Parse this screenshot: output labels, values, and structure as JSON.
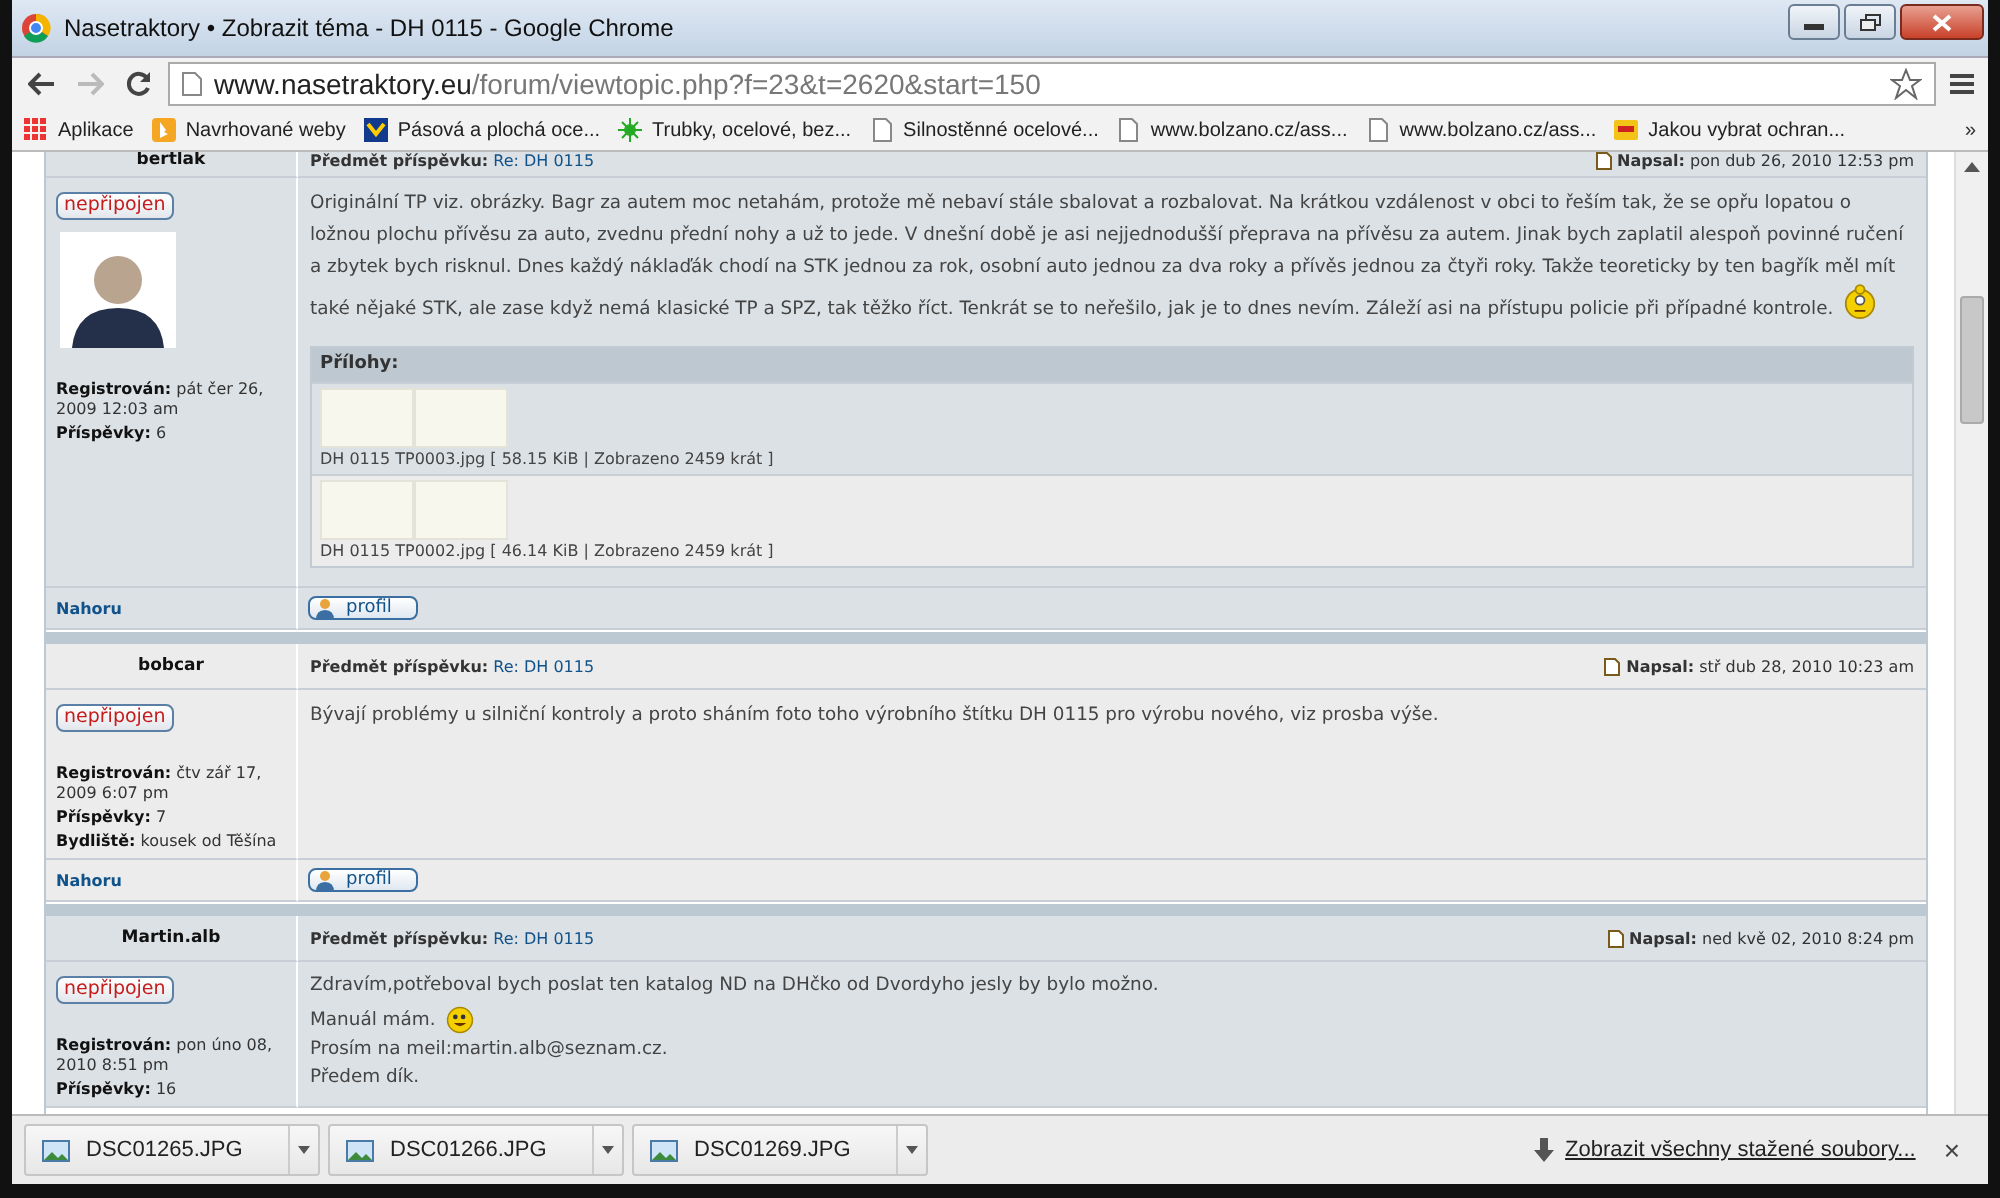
{
  "window": {
    "title": "Nasetraktory • Zobrazit téma - DH 0115 - Google Chrome"
  },
  "address_bar": {
    "domain": "www.nasetraktory.eu",
    "path": "/forum/viewtopic.php?f=23&t=2620&start=150"
  },
  "bookmarks": [
    {
      "label": "Aplikace",
      "kind": "apps"
    },
    {
      "label": "Navrhované weby",
      "kind": "bing"
    },
    {
      "label": "Pásová a plochá oce...",
      "kind": "logo"
    },
    {
      "label": "Trubky, ocelové, bez...",
      "kind": "leaf"
    },
    {
      "label": "Silnostěnné ocelové...",
      "kind": "page"
    },
    {
      "label": "www.bolzano.cz/ass...",
      "kind": "page"
    },
    {
      "label": "www.bolzano.cz/ass...",
      "kind": "page"
    },
    {
      "label": "Jakou vybrat ochran...",
      "kind": "badge"
    }
  ],
  "bookmarks_more": "»",
  "posts": [
    {
      "author": "bertlak",
      "status": "nepřipojen",
      "avatar": true,
      "profile": [
        {
          "label": "Registrován:",
          "value": "pát čer 26, 2009 12:03 am"
        },
        {
          "label": "Příspěvky:",
          "value": "6"
        }
      ],
      "subject_label": "Předmět příspěvku:",
      "subject": "Re: DH 0115",
      "posted_label": "Napsal:",
      "posted": "pon dub 26, 2010 12:53 pm",
      "body": [
        {
          "text": "Originální TP viz. obrázky. Bagr za autem moc netahám, protože mě nebaví stále sbalovat a rozbalovat. Na krátkou vzdálenost v obci to řeším tak, že se opřu lopatou o ložnou plochu přívěsu za auto, zvednu přední nohy a už to jede. V dnešní době je asi nejjednodušší přeprava na přívěsu za autem. Jinak bych zaplatil alespoň povinné ručení a zbytek bych risknul. Dnes každý náklaďák chodí na STK jednou za rok, osobní auto jednou za dva roky a přívěs jednou za čtyři roky. Takže teoreticky by ten bagřík měl mít také nějaké STK, ale zase když nemá klasické TP a SPZ, tak těžko říct. Tenkrát se to neřešilo, jak je to dnes nevím. Záleží asi na přístupu policie při případné kontrole.",
          "emoticon": {
            "kind": "thinking"
          }
        }
      ],
      "attachments_title": "Přílohy:",
      "attachments": [
        {
          "caption": "DH 0115 TP0003.jpg [ 58.15 KiB | Zobrazeno 2459 krát ]"
        },
        {
          "caption": "DH 0115 TP0002.jpg [ 46.14 KiB | Zobrazeno 2459 krát ]"
        }
      ],
      "top_link": "Nahoru",
      "profile_button": "profil"
    },
    {
      "author": "bobcar",
      "status": "nepřipojen",
      "avatar": false,
      "profile": [
        {
          "label": "Registrován:",
          "value": "čtv zář 17, 2009 6:07 pm"
        },
        {
          "label": "Příspěvky:",
          "value": "7"
        },
        {
          "label": "Bydliště:",
          "value": "kousek od Těšína"
        }
      ],
      "subject_label": "Předmět příspěvku:",
      "subject": "Re: DH 0115",
      "posted_label": "Napsal:",
      "posted": "stř dub 28, 2010 10:23 am",
      "body": [
        {
          "text": "Bývají problémy u silniční kontroly a proto sháním foto toho výrobního štítku DH 0115 pro výrobu nového, viz prosba výše."
        }
      ],
      "top_link": "Nahoru",
      "profile_button": "profil"
    },
    {
      "author": "Martin.alb",
      "status": "nepřipojen",
      "avatar": false,
      "profile": [
        {
          "label": "Registrován:",
          "value": "pon úno 08, 2010 8:51 pm"
        },
        {
          "label": "Příspěvky:",
          "value": "16"
        }
      ],
      "subject_label": "Předmět příspěvku:",
      "subject": "Re: DH 0115",
      "posted_label": "Napsal:",
      "posted": "ned kvě 02, 2010 8:24 pm",
      "body": [
        {
          "text": "Zdravím,potřeboval bych poslat ten katalog ND na DHčko od Dvordyho jesly by bylo možno."
        },
        {
          "text": "Manuál mám.",
          "emoticon": {
            "kind": "grin"
          }
        },
        {
          "text": "Prosím na meil:martin.alb@seznam.cz."
        },
        {
          "text": "Předem dík."
        }
      ]
    }
  ],
  "downloads": [
    {
      "name": "DSC01265.JPG"
    },
    {
      "name": "DSC01266.JPG"
    },
    {
      "name": "DSC01269.JPG"
    }
  ],
  "download_bar": {
    "show_all": "Zobrazit všechny stažené soubory...",
    "close": "×"
  }
}
